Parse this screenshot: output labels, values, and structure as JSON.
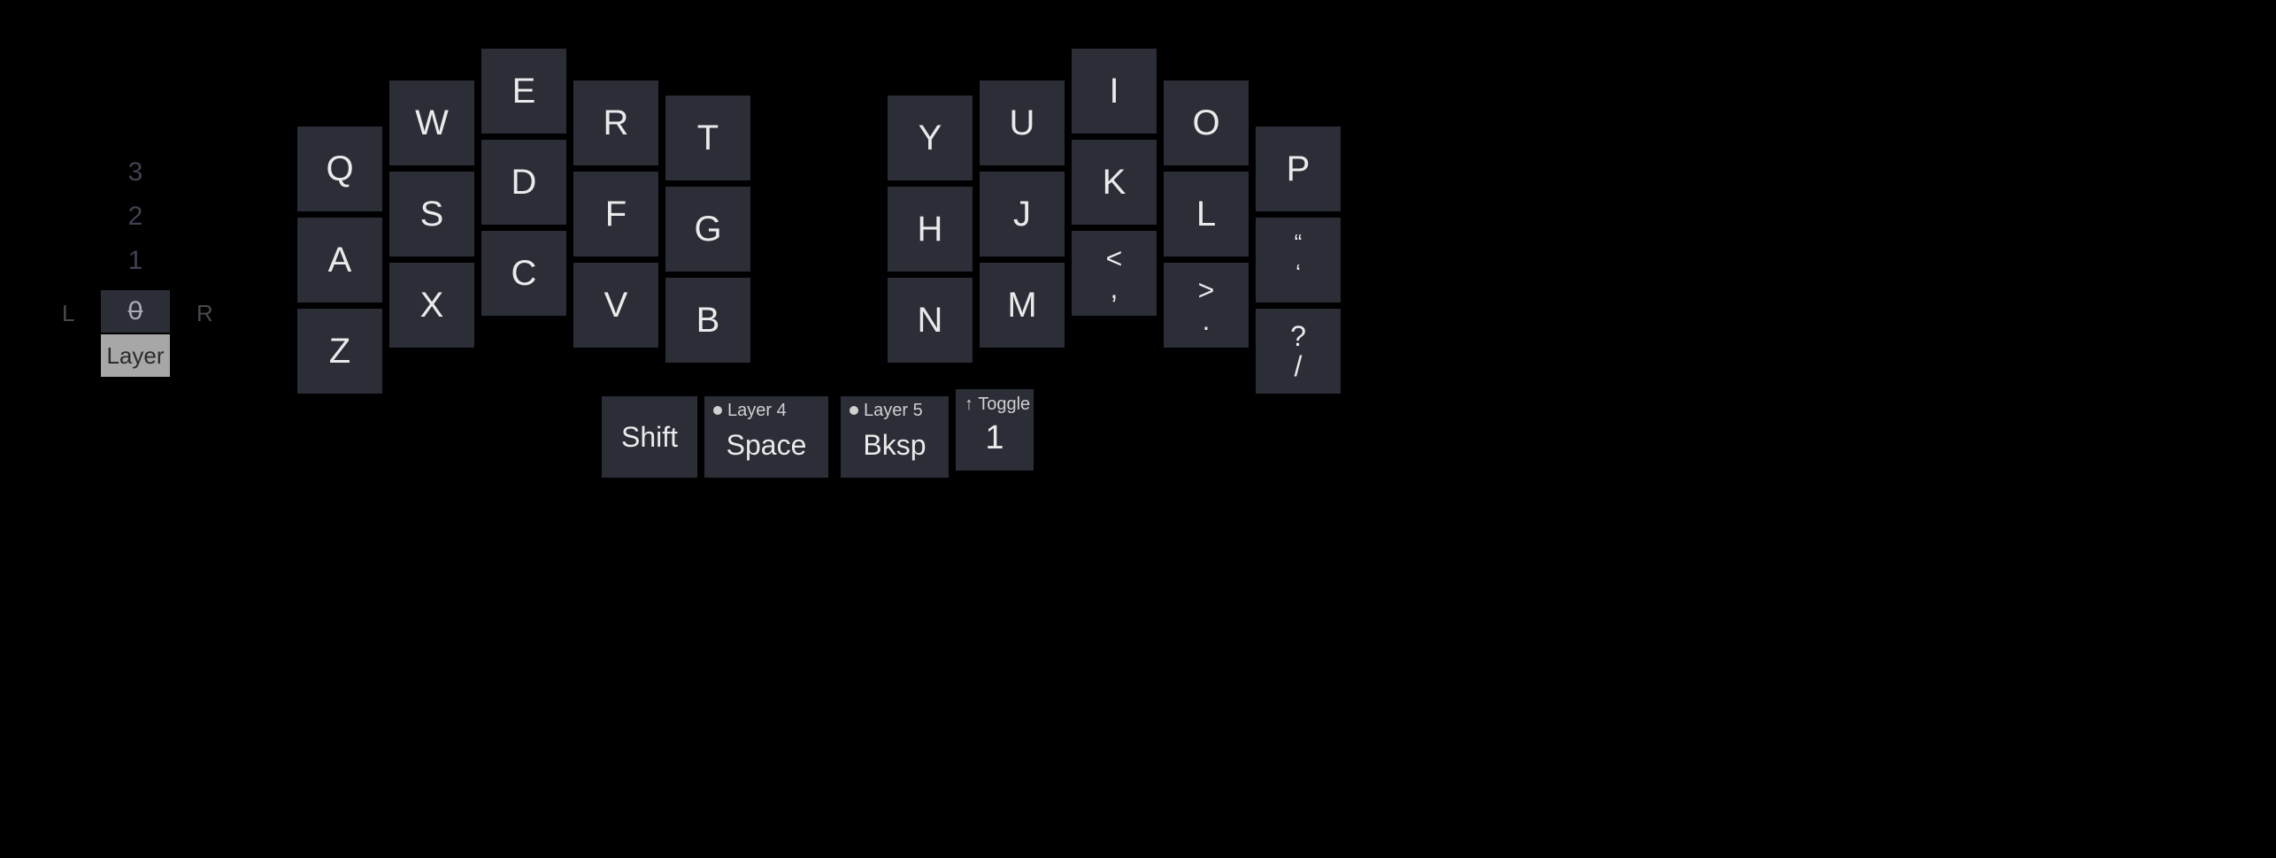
{
  "layerSelector": {
    "sideLeft": "L",
    "sideRight": "R",
    "layers": [
      "3",
      "2",
      "1",
      "0"
    ],
    "activeLayer": "0",
    "label": "Layer"
  },
  "leftHand": {
    "col0": [
      "Q",
      "A",
      "Z"
    ],
    "col1": [
      "W",
      "S",
      "X"
    ],
    "col2": [
      "E",
      "D",
      "C"
    ],
    "col3": [
      "R",
      "F",
      "V"
    ],
    "col4": [
      "T",
      "G",
      "B"
    ]
  },
  "rightHand": {
    "col0": [
      "Y",
      "H",
      "N"
    ],
    "col1": [
      "U",
      "J",
      "M"
    ],
    "col2": [
      "I",
      "K"
    ],
    "col2_punct_top": "<",
    "col2_punct_bot": ",",
    "col3": [
      "O",
      "L"
    ],
    "col3_punct_top": ">",
    "col3_punct_bot": ".",
    "col4_top": "P",
    "col4_mid_top": "“",
    "col4_mid_bot": "‘",
    "col4_bot_top": "?",
    "col4_bot_bot": "/"
  },
  "thumbs": {
    "shift": "Shift",
    "space": "Space",
    "spaceTag": "Layer 4",
    "bksp": "Bksp",
    "bkspTag": "Layer 5",
    "toggleTag": "Toggle",
    "toggleMain": "1"
  }
}
